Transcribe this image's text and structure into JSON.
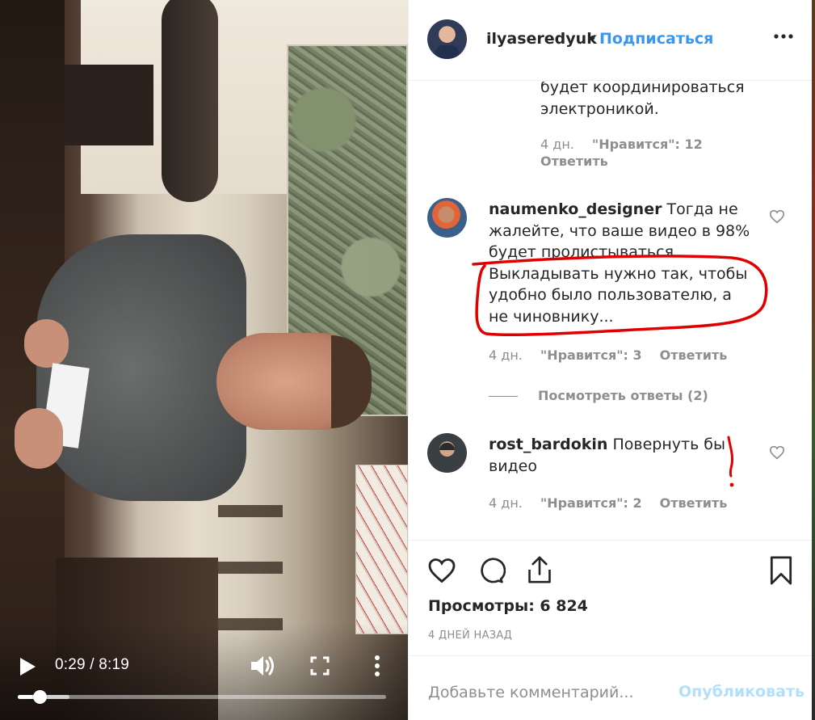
{
  "video": {
    "current_time": "0:29",
    "separator": " / ",
    "duration": "8:19",
    "progress": 0.059,
    "buffered": 0.14,
    "icons": {
      "play": "play-icon",
      "volume": "volume-icon",
      "fullscreen": "fullscreen-icon",
      "more": "more-vertical-icon"
    }
  },
  "header": {
    "username": "ilyaseredyuk",
    "dot": "•",
    "follow_label": "Подписаться",
    "more_icon": "more-horizontal-icon"
  },
  "comments": {
    "partial": {
      "text": "будет координироваться электроникой.",
      "time": "4 дн.",
      "likes": "\"Нравится\": 12",
      "reply": "Ответить"
    },
    "items": [
      {
        "username": "naumenko_designer",
        "text": " Тогда не жалейте, что ваше видео в 98% будет пролистываться. Выкладывать нужно так, чтобы удобно было пользователю, а не чиновнику...",
        "time": "4 дн.",
        "likes": "\"Нравится\": 3",
        "reply": "Ответить",
        "view_replies": "Посмотреть ответы (2)"
      },
      {
        "username": "rost_bardokin",
        "text": " Повернуть бы видео",
        "time": "4 дн.",
        "likes": "\"Нравится\": 2",
        "reply": "Ответить"
      }
    ]
  },
  "actions": {
    "views": "Просмотры: 6 824",
    "date": "4 ДНЕЙ НАЗАД",
    "icons": [
      "heart-icon",
      "comment-icon",
      "share-icon",
      "bookmark-icon"
    ]
  },
  "add_comment": {
    "placeholder": "Добавьте комментарий...",
    "publish_label": "Опубликовать"
  },
  "colors": {
    "link": "#3897f0",
    "publish_disabled": "#b2dffc",
    "muted": "#8e8e8e",
    "annotation": "#e10000"
  }
}
